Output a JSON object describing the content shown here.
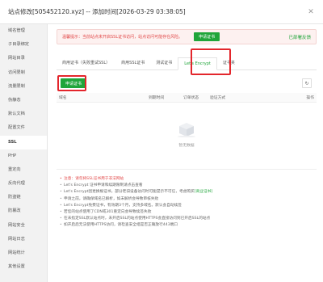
{
  "window": {
    "title": "站点修改[505452120.xyz] -- 添加时间[2026-03-29 03:38:05]"
  },
  "sidebar": {
    "items": [
      {
        "label": "域名管理"
      },
      {
        "label": "子目录绑定"
      },
      {
        "label": "网站目录"
      },
      {
        "label": "访问限制"
      },
      {
        "label": "流量限制"
      },
      {
        "label": "伪静态"
      },
      {
        "label": "默认文档"
      },
      {
        "label": "配置文件"
      },
      {
        "label": "SSL"
      },
      {
        "label": "PHP"
      },
      {
        "label": "重定向"
      },
      {
        "label": "反向代理"
      },
      {
        "label": "防盗链"
      },
      {
        "label": "防篡改"
      },
      {
        "label": "网站安全"
      },
      {
        "label": "网站日志"
      },
      {
        "label": "网站统计"
      },
      {
        "label": "其他设置"
      }
    ],
    "active_index": 8
  },
  "alert": {
    "text": "温馨提示：当前站点未开启SSL证书访问，站点访问可能存在风险。",
    "button": "申请证书",
    "status": "已部署反馈"
  },
  "tabs": [
    {
      "label": "商用证书（失败重试SSL）"
    },
    {
      "label": "商用SSL证书"
    },
    {
      "label": "测试证书"
    },
    {
      "label": "Let's Encrypt"
    },
    {
      "label": "证书夹"
    }
  ],
  "active_tab": 3,
  "toolbar": {
    "apply_button": "申请证书",
    "refresh_icon": "refresh-icon"
  },
  "table": {
    "columns": [
      "域名",
      "到期时间",
      "订单状态",
      "验证方式",
      "操作"
    ]
  },
  "empty_state": {
    "text": "暂无数据"
  },
  "notes": [
    {
      "text": "注意：请勿将SSL证书用于非法网站",
      "warn": true
    },
    {
      "text": "Let's Encrypt 证书申请和续期限制请点击查看"
    },
    {
      "pre": "Let's Encrypt因更换根证书，部分老旧设备访问时可能提示不可信，考虑购买",
      "link": "[商业证书]"
    },
    {
      "text": "申请之前，请确保域名已解析，如未解析会导致审核失败"
    },
    {
      "text": "Let's Encrypt免费证书，有效期3个月，支持多域名。默认会自动续签"
    },
    {
      "text": "若您的站点使用了CDN或301重定向会导致续签失败"
    },
    {
      "text": "在未指定SSL默认站点时，未开启SSL的站点使用HTTPS会直接访问到已开启SSL的站点"
    },
    {
      "text": "如开启后无法使用HTTPS访问，请检查安全组是否正确放行443端口"
    }
  ],
  "colors": {
    "accent": "#20a53a",
    "danger": "#e24b4b",
    "highlight": "#e3262c"
  }
}
